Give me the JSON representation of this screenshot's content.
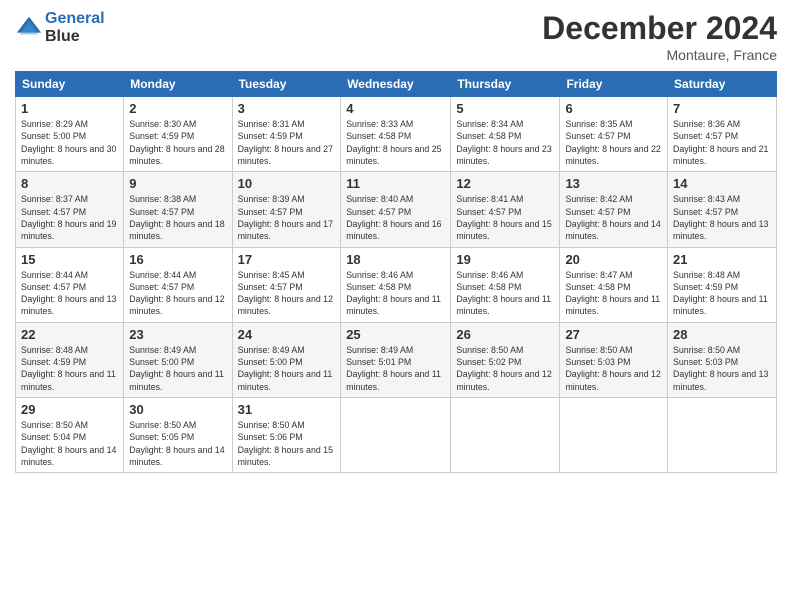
{
  "header": {
    "logo_line1": "General",
    "logo_line2": "Blue",
    "month_title": "December 2024",
    "location": "Montaure, France"
  },
  "weekdays": [
    "Sunday",
    "Monday",
    "Tuesday",
    "Wednesday",
    "Thursday",
    "Friday",
    "Saturday"
  ],
  "weeks": [
    [
      {
        "day": "1",
        "sunrise": "8:29 AM",
        "sunset": "5:00 PM",
        "daylight": "8 hours and 30 minutes."
      },
      {
        "day": "2",
        "sunrise": "8:30 AM",
        "sunset": "4:59 PM",
        "daylight": "8 hours and 28 minutes."
      },
      {
        "day": "3",
        "sunrise": "8:31 AM",
        "sunset": "4:59 PM",
        "daylight": "8 hours and 27 minutes."
      },
      {
        "day": "4",
        "sunrise": "8:33 AM",
        "sunset": "4:58 PM",
        "daylight": "8 hours and 25 minutes."
      },
      {
        "day": "5",
        "sunrise": "8:34 AM",
        "sunset": "4:58 PM",
        "daylight": "8 hours and 23 minutes."
      },
      {
        "day": "6",
        "sunrise": "8:35 AM",
        "sunset": "4:57 PM",
        "daylight": "8 hours and 22 minutes."
      },
      {
        "day": "7",
        "sunrise": "8:36 AM",
        "sunset": "4:57 PM",
        "daylight": "8 hours and 21 minutes."
      }
    ],
    [
      {
        "day": "8",
        "sunrise": "8:37 AM",
        "sunset": "4:57 PM",
        "daylight": "8 hours and 19 minutes."
      },
      {
        "day": "9",
        "sunrise": "8:38 AM",
        "sunset": "4:57 PM",
        "daylight": "8 hours and 18 minutes."
      },
      {
        "day": "10",
        "sunrise": "8:39 AM",
        "sunset": "4:57 PM",
        "daylight": "8 hours and 17 minutes."
      },
      {
        "day": "11",
        "sunrise": "8:40 AM",
        "sunset": "4:57 PM",
        "daylight": "8 hours and 16 minutes."
      },
      {
        "day": "12",
        "sunrise": "8:41 AM",
        "sunset": "4:57 PM",
        "daylight": "8 hours and 15 minutes."
      },
      {
        "day": "13",
        "sunrise": "8:42 AM",
        "sunset": "4:57 PM",
        "daylight": "8 hours and 14 minutes."
      },
      {
        "day": "14",
        "sunrise": "8:43 AM",
        "sunset": "4:57 PM",
        "daylight": "8 hours and 13 minutes."
      }
    ],
    [
      {
        "day": "15",
        "sunrise": "8:44 AM",
        "sunset": "4:57 PM",
        "daylight": "8 hours and 13 minutes."
      },
      {
        "day": "16",
        "sunrise": "8:44 AM",
        "sunset": "4:57 PM",
        "daylight": "8 hours and 12 minutes."
      },
      {
        "day": "17",
        "sunrise": "8:45 AM",
        "sunset": "4:57 PM",
        "daylight": "8 hours and 12 minutes."
      },
      {
        "day": "18",
        "sunrise": "8:46 AM",
        "sunset": "4:58 PM",
        "daylight": "8 hours and 11 minutes."
      },
      {
        "day": "19",
        "sunrise": "8:46 AM",
        "sunset": "4:58 PM",
        "daylight": "8 hours and 11 minutes."
      },
      {
        "day": "20",
        "sunrise": "8:47 AM",
        "sunset": "4:58 PM",
        "daylight": "8 hours and 11 minutes."
      },
      {
        "day": "21",
        "sunrise": "8:48 AM",
        "sunset": "4:59 PM",
        "daylight": "8 hours and 11 minutes."
      }
    ],
    [
      {
        "day": "22",
        "sunrise": "8:48 AM",
        "sunset": "4:59 PM",
        "daylight": "8 hours and 11 minutes."
      },
      {
        "day": "23",
        "sunrise": "8:49 AM",
        "sunset": "5:00 PM",
        "daylight": "8 hours and 11 minutes."
      },
      {
        "day": "24",
        "sunrise": "8:49 AM",
        "sunset": "5:00 PM",
        "daylight": "8 hours and 11 minutes."
      },
      {
        "day": "25",
        "sunrise": "8:49 AM",
        "sunset": "5:01 PM",
        "daylight": "8 hours and 11 minutes."
      },
      {
        "day": "26",
        "sunrise": "8:50 AM",
        "sunset": "5:02 PM",
        "daylight": "8 hours and 12 minutes."
      },
      {
        "day": "27",
        "sunrise": "8:50 AM",
        "sunset": "5:03 PM",
        "daylight": "8 hours and 12 minutes."
      },
      {
        "day": "28",
        "sunrise": "8:50 AM",
        "sunset": "5:03 PM",
        "daylight": "8 hours and 13 minutes."
      }
    ],
    [
      {
        "day": "29",
        "sunrise": "8:50 AM",
        "sunset": "5:04 PM",
        "daylight": "8 hours and 14 minutes."
      },
      {
        "day": "30",
        "sunrise": "8:50 AM",
        "sunset": "5:05 PM",
        "daylight": "8 hours and 14 minutes."
      },
      {
        "day": "31",
        "sunrise": "8:50 AM",
        "sunset": "5:06 PM",
        "daylight": "8 hours and 15 minutes."
      },
      null,
      null,
      null,
      null
    ]
  ],
  "labels": {
    "sunrise": "Sunrise:",
    "sunset": "Sunset:",
    "daylight": "Daylight:"
  }
}
